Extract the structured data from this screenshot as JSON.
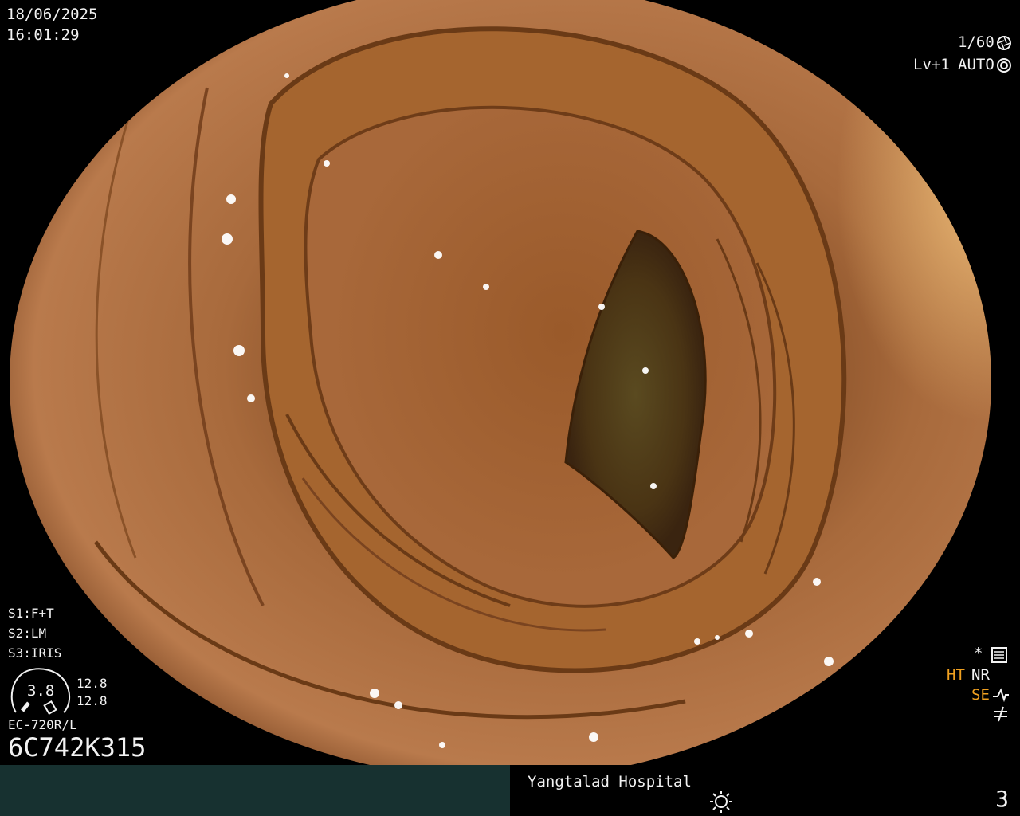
{
  "overlay": {
    "date": "18/06/2025",
    "time": "16:01:29",
    "shutter": "1/60",
    "level": "Lv+1",
    "iris_mode": "AUTO",
    "settings": {
      "s1": "S1:F+T",
      "s2": "S2:LM",
      "s3": "S3:IRIS"
    },
    "gauge": {
      "value": "3.8",
      "top_reading": "12.8",
      "bottom_reading": "12.8"
    },
    "scope_model": "EC-720R/L",
    "serial": "6C742K315",
    "right_panel": {
      "asterisk": "*",
      "ht": "HT",
      "nr": "NR",
      "se": "SE"
    }
  },
  "bottom_bar": {
    "hospital": "Yangtalad Hospital",
    "page_number": "3"
  },
  "colors": {
    "bar_left": "#173130",
    "osd_text": "#f2f2f2",
    "osd_highlight": "#f0a020",
    "mucosa": "#b07040"
  },
  "icons": [
    "shutter-icon",
    "iris-icon",
    "settings-icon",
    "structure-icon",
    "freeze-icon",
    "brightness-icon"
  ]
}
